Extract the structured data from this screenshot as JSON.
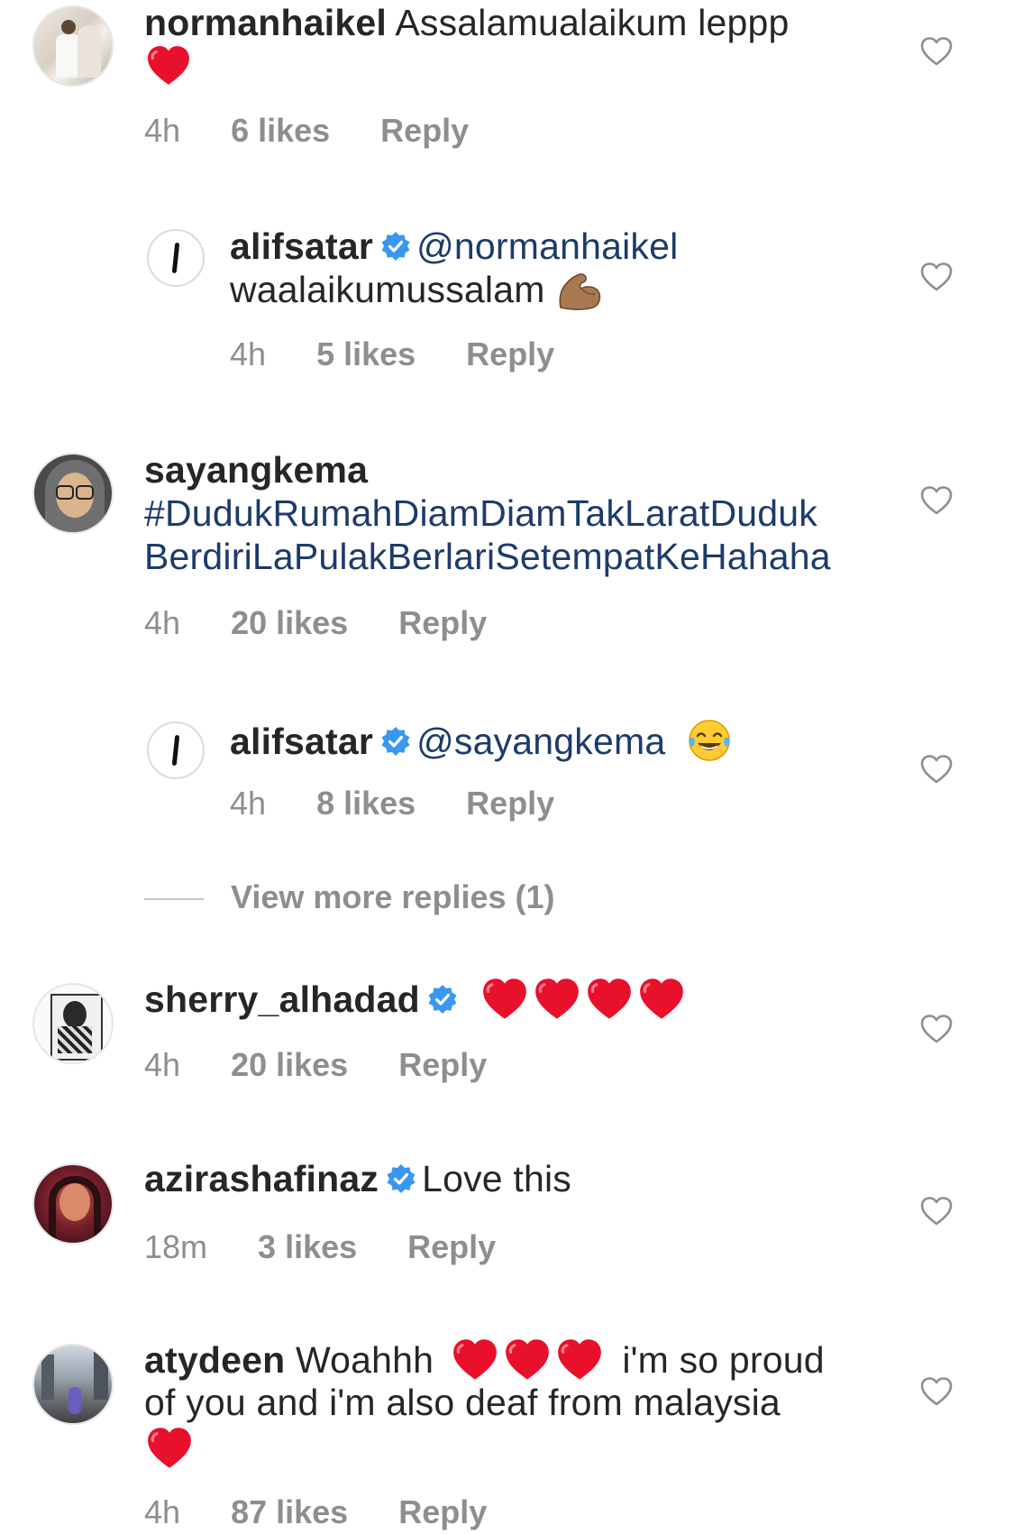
{
  "colors": {
    "username": "#262626",
    "link": "#1d3b6b",
    "meta": "#8e8e8e",
    "verified": "#3897f0",
    "heart": "#e8102b"
  },
  "comments": [
    {
      "username": "normanhaikel",
      "text": "Assalamualaikum leppp",
      "time": "4h",
      "likes": "6 likes",
      "reply": "Reply"
    },
    {
      "username": "alifsatar",
      "mention": "@normanhaikel",
      "text": "waalaikumussalam",
      "time": "4h",
      "likes": "5 likes",
      "reply": "Reply"
    },
    {
      "username": "sayangkema",
      "hashtag_line1": "#DudukRumahDiamDiamTakLaratDuduk",
      "hashtag_line2": "BerdiriLaPulakBerlariSetempatKeHahaha",
      "time": "4h",
      "likes": "20 likes",
      "reply": "Reply"
    },
    {
      "username": "alifsatar",
      "mention": "@sayangkema",
      "time": "4h",
      "likes": "8 likes",
      "reply": "Reply"
    },
    {
      "username": "sherry_alhadad",
      "time": "4h",
      "likes": "20 likes",
      "reply": "Reply"
    },
    {
      "username": "azirashafinaz",
      "text": "Love this",
      "time": "18m",
      "likes": "3 likes",
      "reply": "Reply"
    },
    {
      "username": "atydeen",
      "text_a": "Woahhh",
      "text_b": "i'm so proud",
      "text_line2": "of you and i'm also deaf from malaysia",
      "time": "4h",
      "likes": "87 likes",
      "reply": "Reply"
    }
  ],
  "view_more": "View more replies (1)"
}
